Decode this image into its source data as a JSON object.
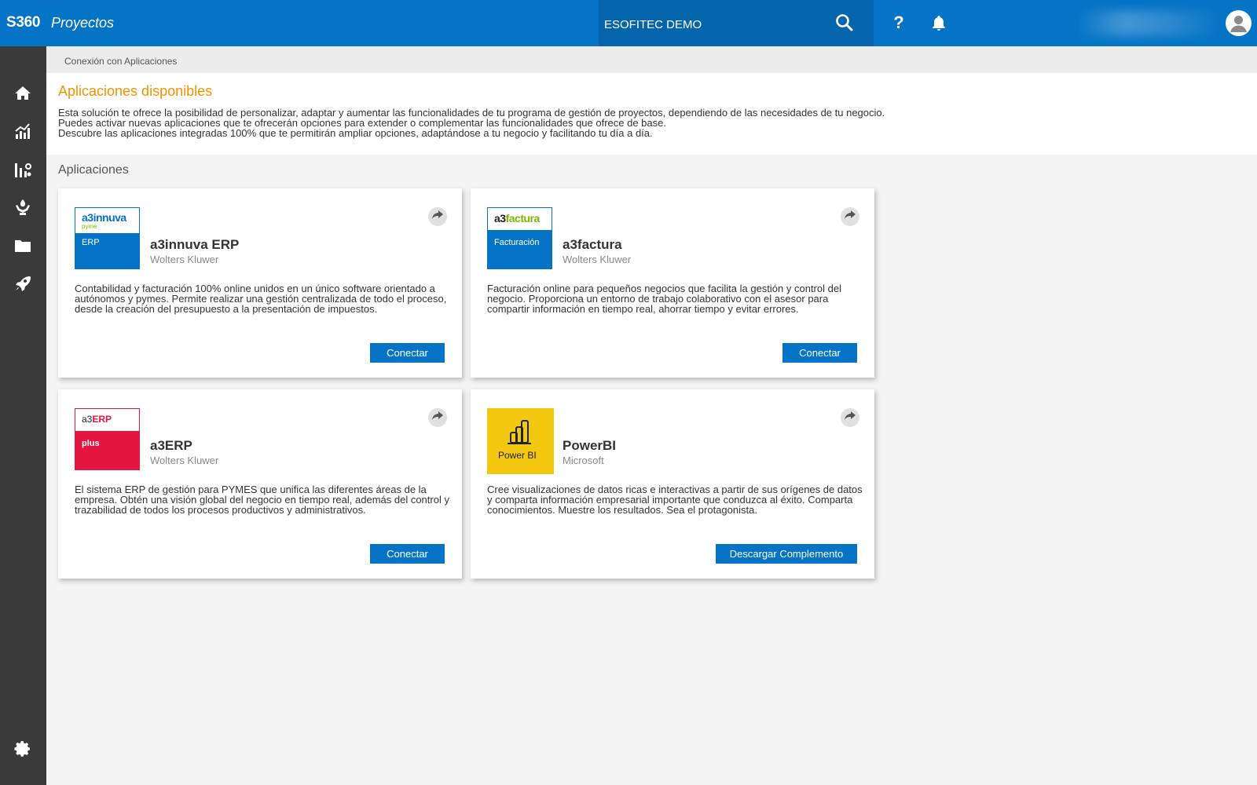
{
  "header": {
    "brand": "S360",
    "product": "Proyectos",
    "company": "ESOFITEC DEMO",
    "help_label": "?"
  },
  "sidebar": {
    "items": [
      "home-icon",
      "chart-icon",
      "analytics-icon",
      "hands-icon",
      "folder-icon",
      "rocket-icon",
      "gear-icon"
    ]
  },
  "breadcrumb": "Conexión con Aplicaciones",
  "intro": {
    "title": "Aplicaciones disponibles",
    "lines": [
      "Esta solución te ofrece la posibilidad de personalizar, adaptar y aumentar las funcionalidades de tu programa de gestión de proyectos, dependiendo de las necesidades de tu negocio.",
      "Puedes activar nuevas aplicaciones que te ofrecerán opciones para extender o complementar las funcionalidades que ofrece de base.",
      "Descubre las aplicaciones integradas 100% que te permitirán ampliar opciones, adaptándose a tu negocio y facilitando tu día a día."
    ]
  },
  "section_title": "Aplicaciones",
  "apps": [
    {
      "name": "a3innuva ERP",
      "vendor": "Wolters Kluwer",
      "logo_main": "a3innuva",
      "logo_sub": "pyme",
      "logo_label": "ERP",
      "description": "Contabilidad y facturación 100% online unidos en un único software orientado a autónomos y pymes. Permite realizar una gestión centralizada de todo el proceso, desde la creación del presupuesto a la presentación de impuestos.",
      "action": "Conectar"
    },
    {
      "name": "a3factura",
      "vendor": "Wolters Kluwer",
      "logo_main_a3": "a3",
      "logo_main_rest": "factura",
      "logo_label": "Facturación",
      "description": "Facturación online para pequeños negocios que facilita la gestión y control del negocio. Proporciona un entorno de trabajo colaborativo con el asesor para compartir información en tiempo real, ahorrar tiempo y evitar errores.",
      "action": "Conectar"
    },
    {
      "name": "a3ERP",
      "vendor": "Wolters Kluwer",
      "logo_main_a3": "a3",
      "logo_main_rest": "ERP",
      "logo_label": "plus",
      "description": "El sistema ERP de gestión para PYMES que unifica las diferentes áreas de la empresa. Obtén una visión global del negocio en tiempo real, además del control y trazabilidad de todos los procesos productivos y administrativos.",
      "action": "Conectar"
    },
    {
      "name": "PowerBI",
      "vendor": "Microsoft",
      "logo_label": "Power BI",
      "description": "Cree visualizaciones de datos ricas e interactivas a partir de sus orígenes de datos y comparta información empresarial importante que conduzca al éxito. Comparta conocimientos. Muestre los resultados. Sea el protagonista.",
      "action": "Descargar Complemento"
    }
  ],
  "colors": {
    "primary": "#0574c6",
    "sidebar": "#3a3a3a",
    "accent_orange": "#f39200",
    "a3erp_red": "#e4153f",
    "powerbi_yellow": "#f2c811"
  }
}
